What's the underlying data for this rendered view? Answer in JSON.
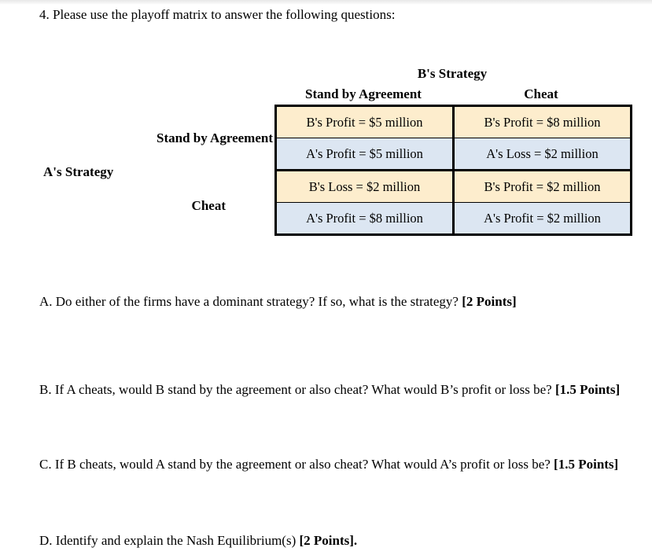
{
  "document": {
    "prompt": "4. Please use the playoff matrix to answer the following questions:"
  },
  "matrix": {
    "column_axis_title": "B's Strategy",
    "row_axis_title": "A's Strategy",
    "column_headers": [
      "Stand by Agreement",
      "Cheat"
    ],
    "row_headers": [
      "Stand by Agreement",
      "Cheat"
    ],
    "cells": [
      [
        {
          "b_payoff": "B's Profit = $5 million",
          "a_payoff": "A's Profit = $5 million"
        },
        {
          "b_payoff": "B's Profit = $8 million",
          "a_payoff": "A's Loss = $2 million"
        }
      ],
      [
        {
          "b_payoff": "B's Loss = $2 million",
          "a_payoff": "A's Profit = $8 million"
        },
        {
          "b_payoff": "B's Profit = $2 million",
          "a_payoff": "A's Profit = $2 million"
        }
      ]
    ],
    "colors": {
      "b_row_fill": "#fdedcd",
      "a_row_fill": "#dce6f2",
      "border": "#000000"
    }
  },
  "questions": [
    {
      "id": "a",
      "text": "A. Do either of the firms have a dominant strategy? If so, what is the strategy? ",
      "points": "[2 Points]",
      "tail": ""
    },
    {
      "id": "b",
      "text": "B. If A cheats, would B stand by the agreement or also cheat? What would B’s profit or loss be?",
      "points": "[1.5 Points]",
      "tail": ""
    },
    {
      "id": "c",
      "text": "C. If B cheats, would A stand by the agreement or also cheat? What would A’s profit or loss be?",
      "points": "[1.5 Points]",
      "tail": ""
    },
    {
      "id": "d",
      "text": "D. Identify and explain the Nash Equilibrium(s) ",
      "points": "[2 Points]",
      "tail": "."
    }
  ]
}
